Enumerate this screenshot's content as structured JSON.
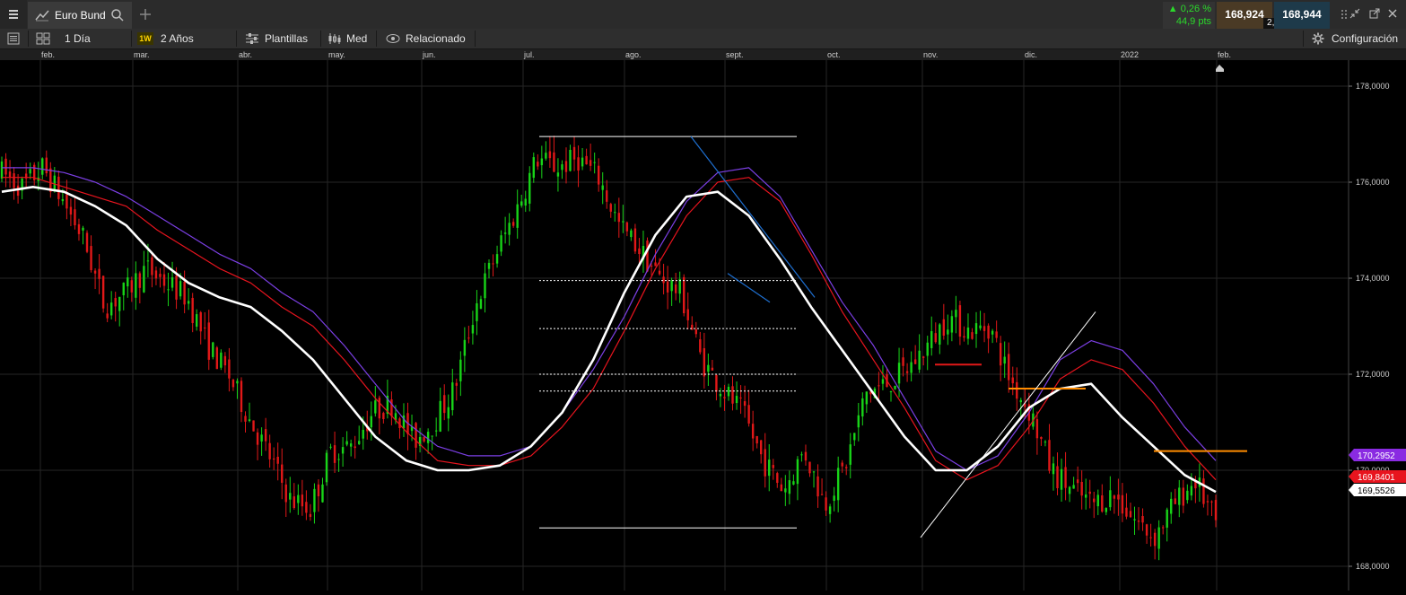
{
  "header": {
    "title": "Euro Bund",
    "change_pct": "▲ 0,26 %",
    "change_pts": "44,9 pts",
    "bid": "168,924",
    "ask": "168,944",
    "spread": "2,0"
  },
  "toolbar": {
    "interval": "1 Día",
    "period_badge": "1W",
    "period": "2 Años",
    "templates": "Plantillas",
    "indicator": "Med",
    "related": "Relacionado",
    "settings": "Configuración"
  },
  "chart_data": {
    "type": "candlestick",
    "instrument": "Euro Bund",
    "x_tick_labels": [
      "feb.",
      "mar.",
      "abr.",
      "may.",
      "jun.",
      "jul.",
      "ago.",
      "sept.",
      "oct.",
      "nov.",
      "dic.",
      "2022",
      "feb."
    ],
    "y_tick_labels": [
      "178,0000",
      "176,0000",
      "174,0000",
      "172,0000",
      "170,0000",
      "168,0000"
    ],
    "ylim": [
      167.8,
      178.5
    ],
    "grid": true,
    "price_labels": [
      {
        "value": "170,2952",
        "color": "#8a2be2"
      },
      {
        "value": "169,8401",
        "color": "#e8141e"
      },
      {
        "value": "169,5526",
        "color": "#ffffff"
      }
    ],
    "moving_averages": [
      {
        "color": "#7b3fe4",
        "values": [
          176.3,
          176.3,
          176.2,
          176.0,
          175.7,
          175.3,
          174.9,
          174.5,
          174.2,
          173.7,
          173.3,
          172.6,
          171.8,
          171.0,
          170.5,
          170.3,
          170.3,
          170.5,
          171.2,
          172.1,
          173.2,
          174.5,
          175.6,
          176.2,
          176.3,
          175.7,
          174.6,
          173.5,
          172.6,
          171.5,
          170.4,
          170.0,
          170.3,
          171.2,
          172.3,
          172.7,
          172.5,
          171.8,
          170.9,
          170.2
        ]
      },
      {
        "color": "#e8141e",
        "values": [
          176.1,
          176.1,
          175.9,
          175.7,
          175.5,
          175.0,
          174.6,
          174.2,
          173.9,
          173.4,
          173.0,
          172.3,
          171.5,
          170.8,
          170.2,
          170.1,
          170.1,
          170.3,
          170.9,
          171.7,
          172.9,
          174.2,
          175.3,
          176.0,
          176.1,
          175.6,
          174.5,
          173.3,
          172.3,
          171.3,
          170.2,
          169.8,
          170.1,
          170.9,
          171.9,
          172.3,
          172.1,
          171.4,
          170.5,
          169.8
        ]
      },
      {
        "color": "#ffffff",
        "values": [
          175.8,
          175.9,
          175.8,
          175.5,
          175.1,
          174.4,
          173.9,
          173.6,
          173.4,
          172.9,
          172.3,
          171.5,
          170.7,
          170.2,
          170.0,
          170.0,
          170.1,
          170.5,
          171.2,
          172.3,
          173.7,
          174.9,
          175.7,
          175.8,
          175.3,
          174.4,
          173.4,
          172.5,
          171.6,
          170.7,
          170.0,
          170.0,
          170.5,
          171.3,
          171.7,
          171.8,
          171.1,
          170.5,
          169.9,
          169.55
        ]
      }
    ],
    "close_path": [
      176.2,
      175.9,
      176.3,
      175.6,
      174.8,
      173.4,
      173.7,
      174.2,
      173.9,
      173.6,
      172.6,
      172.0,
      171.1,
      170.3,
      169.4,
      169.2,
      170.4,
      170.5,
      171.2,
      171.4,
      170.6,
      171.0,
      171.7,
      173.4,
      174.5,
      175.4,
      176.5,
      176.3,
      176.5,
      176.1,
      175.1,
      174.6,
      174.0,
      173.7,
      172.3,
      171.7,
      171.2,
      170.2,
      169.6,
      170.4,
      169.3,
      170.1,
      171.6,
      171.8,
      172.1,
      172.6,
      173.2,
      172.9,
      173.0,
      171.9,
      171.2,
      170.0,
      169.6,
      169.3,
      169.5,
      169.0,
      168.6,
      169.3,
      169.8,
      168.9
    ]
  }
}
